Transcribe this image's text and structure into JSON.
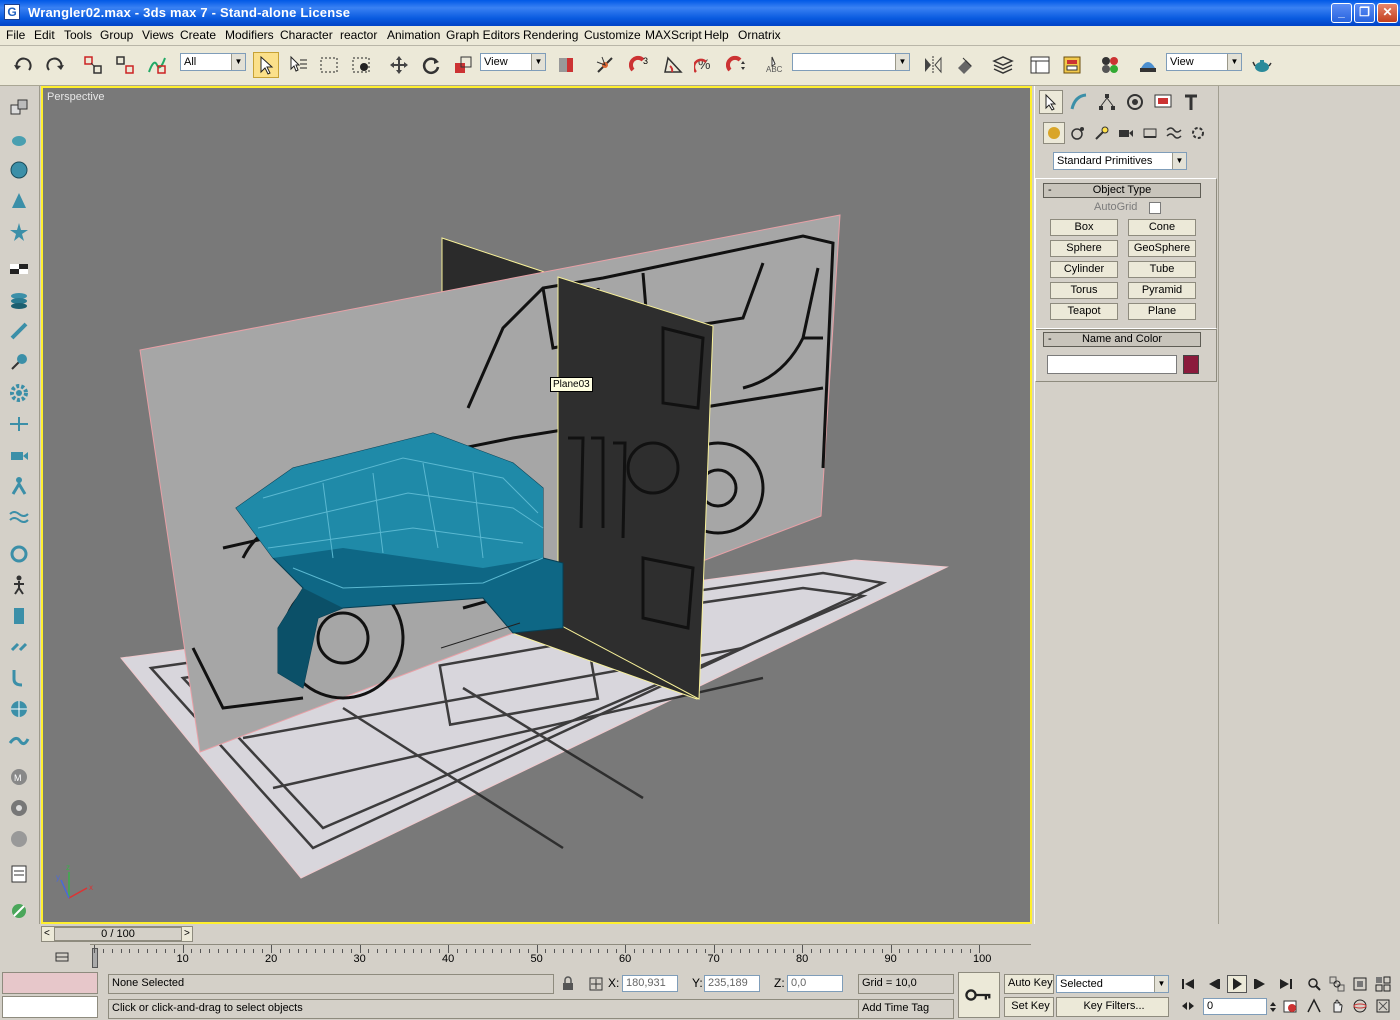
{
  "window": {
    "title": "Wrangler02.max - 3ds max 7  - Stand-alone License",
    "app_icon": "G"
  },
  "menu": [
    "File",
    "Edit",
    "Tools",
    "Group",
    "Views",
    "Create",
    "Modifiers",
    "Character",
    "reactor",
    "Animation",
    "Graph Editors",
    "Rendering",
    "Customize",
    "MAXScript",
    "Help",
    "Ornatrix"
  ],
  "toolbar": {
    "selection_filter": "All",
    "ref_coord": "View",
    "named_selection": "",
    "render_view": "View"
  },
  "viewport": {
    "label": "Perspective",
    "tooltip": "Plane03",
    "axis_labels": [
      "x",
      "y",
      "z"
    ]
  },
  "command_panel": {
    "category": "Standard Primitives",
    "object_type": {
      "title": "Object Type",
      "autogrid": "AutoGrid",
      "buttons": [
        "Box",
        "Cone",
        "Sphere",
        "GeoSphere",
        "Cylinder",
        "Tube",
        "Torus",
        "Pyramid",
        "Teapot",
        "Plane"
      ]
    },
    "name_color": {
      "title": "Name and Color",
      "name_value": "",
      "color": "#8b1a3c"
    }
  },
  "timeline": {
    "slider": "0 / 100",
    "ticks": [
      "0",
      "10",
      "20",
      "30",
      "40",
      "50",
      "60",
      "70",
      "80",
      "90",
      "100"
    ]
  },
  "status": {
    "selection": "None Selected",
    "prompt": "Click or click-and-drag to select objects",
    "x_label": "X:",
    "x": "180,931",
    "y_label": "Y:",
    "y": "235,189",
    "z_label": "Z:",
    "z": "0,0",
    "grid": "Grid = 10,0",
    "add_time_tag": "Add Time Tag",
    "auto_key": "Auto Key",
    "set_key": "Set Key",
    "key_mode": "Selected",
    "key_filters": "Key Filters...",
    "frame": "0"
  }
}
